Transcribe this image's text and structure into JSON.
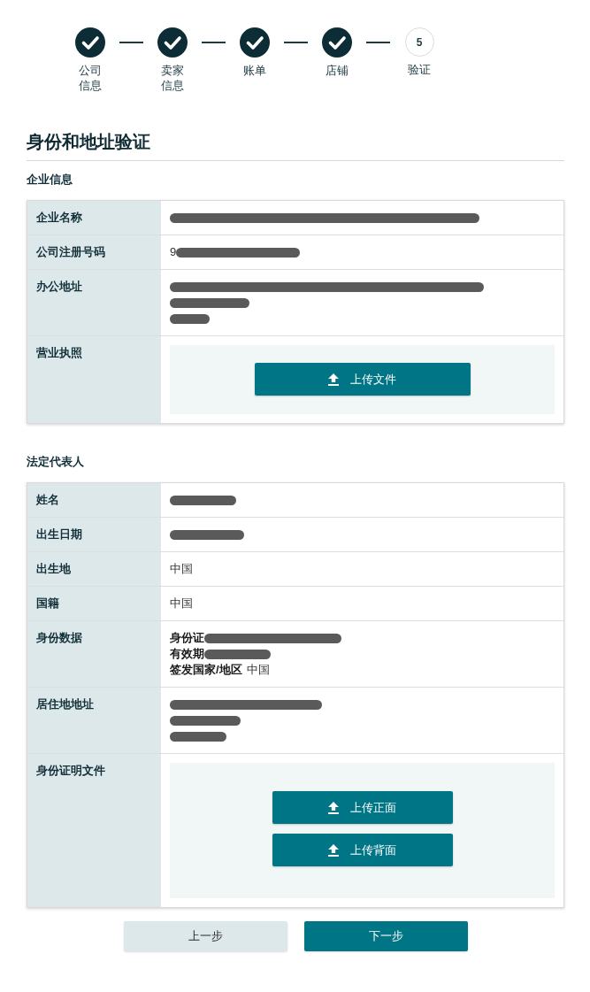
{
  "stepper": {
    "steps": [
      {
        "label": "公司信息",
        "done": true
      },
      {
        "label": "卖家信息",
        "done": true
      },
      {
        "label": "账单",
        "done": true
      },
      {
        "label": "店铺",
        "done": true
      },
      {
        "number": "5",
        "label": "验证",
        "done": false
      }
    ]
  },
  "title": "身份和地址验证",
  "sections": [
    {
      "heading": "企业信息",
      "rows": [
        {
          "label": "企业名称",
          "kind": "text",
          "lines": [
            {
              "redacted": true
            }
          ]
        },
        {
          "label": "公司注册号码",
          "kind": "text",
          "lines": [
            {
              "text": "9",
              "redacted": true
            }
          ]
        },
        {
          "label": "办公地址",
          "kind": "text",
          "lines": [
            {
              "redacted": true
            },
            {
              "redacted": true
            },
            {
              "redacted": true
            }
          ]
        },
        {
          "label": "营业执照",
          "kind": "upload",
          "buttons": [
            {
              "label": "上传文件"
            }
          ]
        }
      ]
    },
    {
      "heading": "法定代表人",
      "rows": [
        {
          "label": "姓名",
          "kind": "text",
          "lines": [
            {
              "redacted": true
            }
          ]
        },
        {
          "label": "出生日期",
          "kind": "text",
          "lines": [
            {
              "redacted": true
            }
          ]
        },
        {
          "label": "出生地",
          "kind": "text",
          "lines": [
            {
              "text": "中国",
              "redacted": false
            }
          ]
        },
        {
          "label": "国籍",
          "kind": "text",
          "lines": [
            {
              "text": "中国",
              "redacted": false
            }
          ]
        },
        {
          "label": "身份数据",
          "kind": "text",
          "lines": [
            {
              "prefix": "身份证",
              "redacted": true
            },
            {
              "prefix": "有效期",
              "redacted": true
            },
            {
              "prefix": "签发国家/地区",
              "text": "中国",
              "redacted": false
            }
          ]
        },
        {
          "label": "居住地地址",
          "kind": "text",
          "lines": [
            {
              "redacted": true
            },
            {
              "redacted": true
            },
            {
              "redacted": true
            }
          ]
        },
        {
          "label": "身份证明文件",
          "kind": "upload",
          "buttons": [
            {
              "label": "上传正面"
            },
            {
              "label": "上传背面"
            }
          ]
        }
      ]
    }
  ],
  "actions": [
    {
      "label": "上一步",
      "primary": false
    },
    {
      "label": "下一步",
      "primary": true
    }
  ]
}
